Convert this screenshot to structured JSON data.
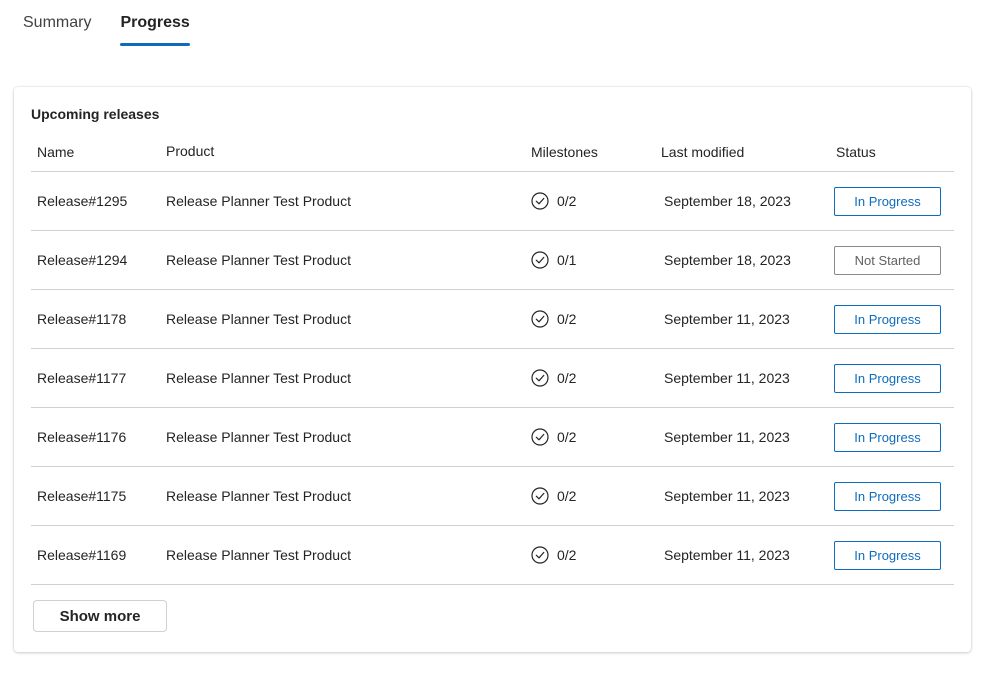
{
  "tabs": [
    {
      "label": "Summary",
      "active": false
    },
    {
      "label": "Progress",
      "active": true
    }
  ],
  "card": {
    "title": "Upcoming releases",
    "columns": {
      "name": "Name",
      "product": "Product",
      "milestones": "Milestones",
      "last_modified": "Last modified",
      "status": "Status"
    },
    "rows": [
      {
        "name": "Release#1295",
        "product": "Release Planner Test Product",
        "milestones": "0/2",
        "last_modified": "September 18, 2023",
        "status": "In Progress"
      },
      {
        "name": "Release#1294",
        "product": "Release Planner Test Product",
        "milestones": "0/1",
        "last_modified": "September 18, 2023",
        "status": "Not Started"
      },
      {
        "name": "Release#1178",
        "product": "Release Planner Test Product",
        "milestones": "0/2",
        "last_modified": "September 11, 2023",
        "status": "In Progress"
      },
      {
        "name": "Release#1177",
        "product": "Release Planner Test Product",
        "milestones": "0/2",
        "last_modified": "September 11, 2023",
        "status": "In Progress"
      },
      {
        "name": "Release#1176",
        "product": "Release Planner Test Product",
        "milestones": "0/2",
        "last_modified": "September 11, 2023",
        "status": "In Progress"
      },
      {
        "name": "Release#1175",
        "product": "Release Planner Test Product",
        "milestones": "0/2",
        "last_modified": "September 11, 2023",
        "status": "In Progress"
      },
      {
        "name": "Release#1169",
        "product": "Release Planner Test Product",
        "milestones": "0/2",
        "last_modified": "September 11, 2023",
        "status": "In Progress"
      }
    ],
    "milestone_icon": "check-circle-icon",
    "show_more_label": "Show more"
  },
  "colors": {
    "accent": "#0f6cbd",
    "not_started": "#616161",
    "divider": "#d1d1d1"
  }
}
